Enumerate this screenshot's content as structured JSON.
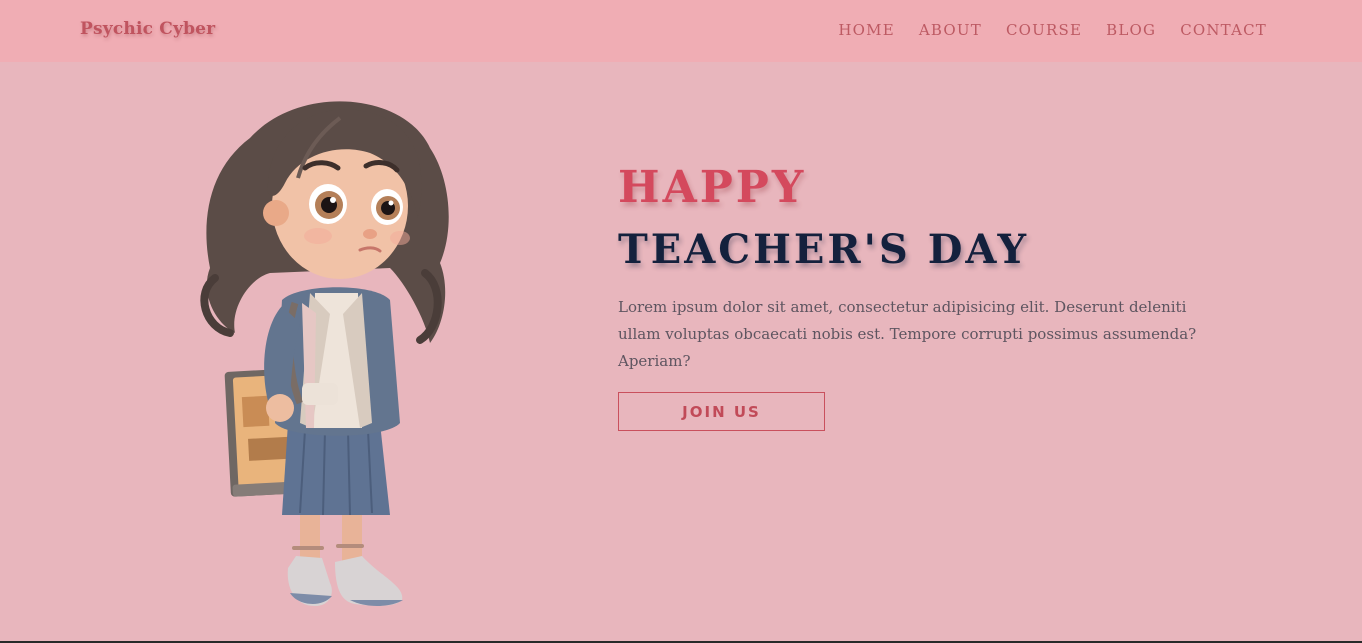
{
  "navbar": {
    "brand": "Psychic Cyber",
    "links": [
      {
        "label": "HOME"
      },
      {
        "label": "ABOUT"
      },
      {
        "label": "COURSE"
      },
      {
        "label": "BLOG"
      },
      {
        "label": "CONTACT"
      }
    ]
  },
  "hero": {
    "heading_line1": "HAPPY",
    "heading_line2": "TEACHER'S DAY",
    "description": "Lorem ipsum dolor sit amet, consectetur adipisicing elit. Deserunt deleniti ullam voluptas obcaecati nobis est. Tempore corrupti possimus assumenda? Aperiam?",
    "button_label": "JOIN US",
    "image_icon": "cartoon-girl-student-illustration"
  },
  "colors": {
    "page_background": "#e8b6bd",
    "navbar_background": "#f0adb4",
    "accent": "#d4495d",
    "heading_dark": "#14213d"
  }
}
